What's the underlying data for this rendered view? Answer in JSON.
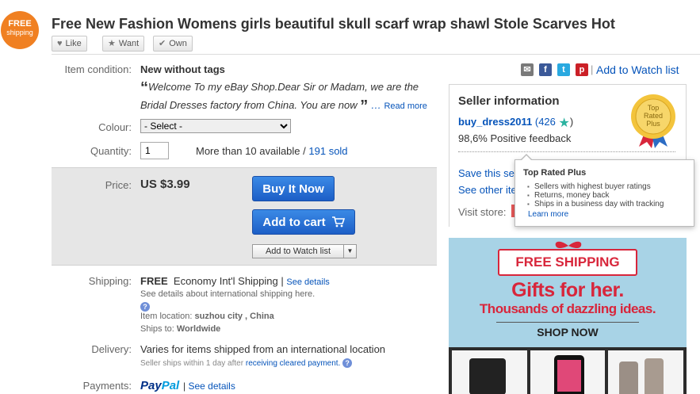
{
  "header": {
    "badge_line1": "FREE",
    "badge_line2": "shipping",
    "title": "Free New Fashion Womens girls beautiful skull scarf wrap shawl Stole Scarves Hot",
    "like_label": "Like",
    "want_label": "Want",
    "own_label": "Own"
  },
  "item": {
    "condition_label": "Item condition:",
    "condition_value": "New without tags",
    "quote_text": "Welcome To my eBay Shop.Dear Sir or Madam, we are the Bridal Dresses factory from China. You are now",
    "read_more": "Read more",
    "colour_label": "Colour:",
    "colour_selected": "- Select -",
    "quantity_label": "Quantity:",
    "quantity_value": "1",
    "available_text": "More than 10 available /",
    "sold_text": "191 sold"
  },
  "price": {
    "label": "Price:",
    "value": "US $3.99",
    "buy_now": "Buy It Now",
    "add_to_cart": "Add to cart",
    "add_to_watch": "Add to Watch list"
  },
  "shipping": {
    "label": "Shipping:",
    "free": "FREE",
    "method": "Economy Int'l Shipping",
    "see_details": "See details",
    "intl_note": "See details about international shipping here.",
    "location_label": "Item location:",
    "location_value": "suzhou city , China",
    "ships_to_label": "Ships to:",
    "ships_to_value": "Worldwide"
  },
  "delivery": {
    "label": "Delivery:",
    "text": "Varies for items shipped from an international location",
    "note_prefix": "Seller ships within 1 day after",
    "note_link": "receiving cleared payment."
  },
  "payments": {
    "label": "Payments:",
    "paypal_1": "Pay",
    "paypal_2": "Pal",
    "see_details": "See details"
  },
  "share": {
    "watch_link": "Add to Watch list",
    "icons": [
      "email-icon",
      "facebook-icon",
      "twitter-icon",
      "pinterest-icon"
    ]
  },
  "seller": {
    "title": "Seller information",
    "name": "buy_dress2011",
    "score": "(426",
    "score_close": ")",
    "feedback": "98,6% Positive feedback",
    "save_link": "Save this se",
    "other_link": "See other ite",
    "visit_label": "Visit store:",
    "medal_text_1": "Top",
    "medal_text_2": "Rated",
    "medal_text_3": "Plus"
  },
  "tooltip": {
    "title": "Top Rated Plus",
    "items": [
      "Sellers with highest buyer ratings",
      "Returns, money back",
      "Ships in a business day with tracking"
    ],
    "learn_more": "Learn more"
  },
  "ad": {
    "ribbon": "FREE SHIPPING",
    "headline": "Gifts for her.",
    "subline": "Thousands of dazzling ideas.",
    "cta": "SHOP NOW"
  },
  "colors": {
    "link": "#0654ba",
    "badge": "#f08022",
    "button_blue": "#1c5ec6",
    "ad_red": "#d8263b",
    "ad_bg": "#a8d3e6"
  }
}
